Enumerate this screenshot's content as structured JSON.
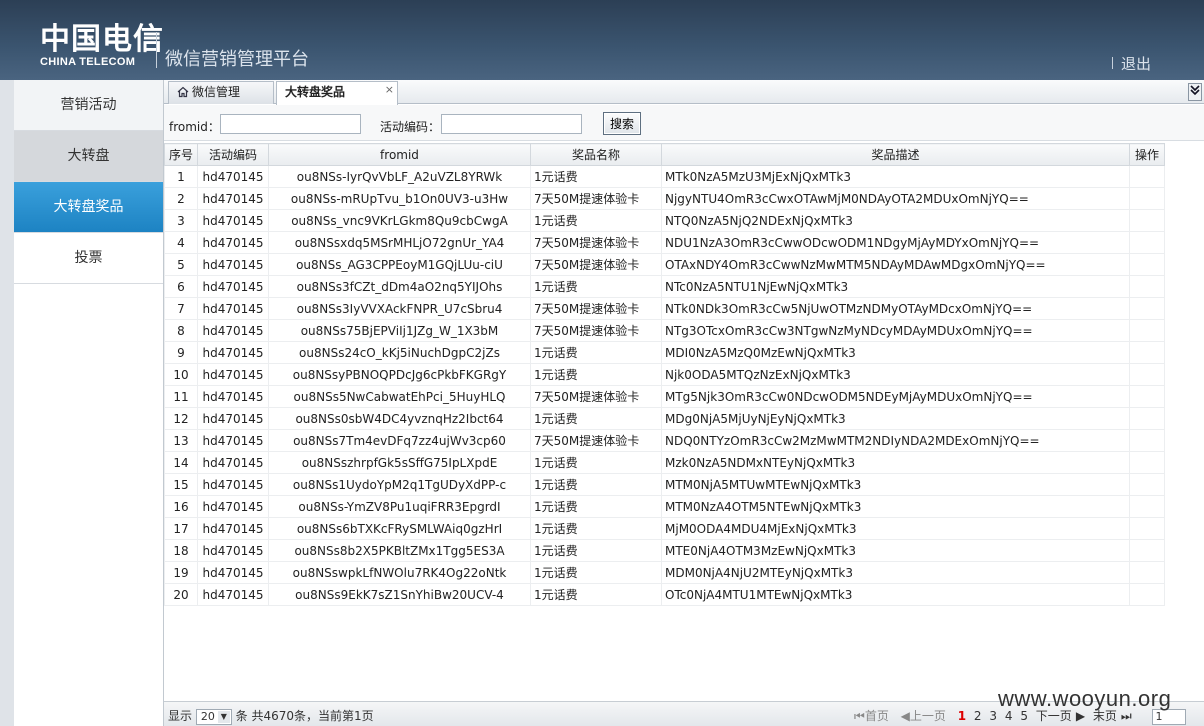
{
  "header": {
    "logo_cn": "中国电信",
    "logo_en": "CHINA TELECOM",
    "platform_title": "微信营销管理平台",
    "logout_label": "退出"
  },
  "sidebar": {
    "items": [
      {
        "label": "营销活动"
      },
      {
        "label": "大转盘"
      },
      {
        "label": "大转盘奖品"
      },
      {
        "label": "投票"
      }
    ]
  },
  "tabs": [
    {
      "label": "微信管理"
    },
    {
      "label": "大转盘奖品",
      "close": "×"
    }
  ],
  "tab_scroll_icon": "double-chevron-down-icon",
  "search": {
    "fromid_label": "fromid：",
    "fromid_value": "",
    "activity_label": "活动编码：",
    "activity_value": "",
    "button_label": "搜索"
  },
  "table": {
    "columns": [
      "序号",
      "活动编码",
      "fromid",
      "奖品名称",
      "奖品描述",
      "操作"
    ],
    "rows": [
      [
        "1",
        "hd470145",
        "ou8NSs-IyrQvVbLF_A2uVZL8YRWk",
        "1元话费",
        "MTk0NzA5MzU3MjExNjQxMTk3",
        ""
      ],
      [
        "2",
        "hd470145",
        "ou8NSs-mRUpTvu_b1On0UV3-u3Hw",
        "7天50M提速体验卡",
        "NjgyNTU4OmR3cCwxOTAwMjM0NDAyOTA2MDUxOmNjYQ==",
        ""
      ],
      [
        "3",
        "hd470145",
        "ou8NSs_vnc9VKrLGkm8Qu9cbCwgA",
        "1元话费",
        "NTQ0NzA5NjQ2NDExNjQxMTk3",
        ""
      ],
      [
        "4",
        "hd470145",
        "ou8NSsxdq5MSrMHLjO72gnUr_YA4",
        "7天50M提速体验卡",
        "NDU1NzA3OmR3cCwwODcwODM1NDgyMjAyMDYxOmNjYQ==",
        ""
      ],
      [
        "5",
        "hd470145",
        "ou8NSs_AG3CPPEoyM1GQjLUu-ciU",
        "7天50M提速体验卡",
        "OTAxNDY4OmR3cCwwNzMwMTM5NDAyMDAwMDgxOmNjYQ==",
        ""
      ],
      [
        "6",
        "hd470145",
        "ou8NSs3fCZt_dDm4aO2nq5YIJOhs",
        "1元话费",
        "NTc0NzA5NTU1NjEwNjQxMTk3",
        ""
      ],
      [
        "7",
        "hd470145",
        "ou8NSs3IyVVXAckFNPR_U7cSbru4",
        "7天50M提速体验卡",
        "NTk0NDk3OmR3cCw5NjUwOTMzNDMyOTAyMDcxOmNjYQ==",
        ""
      ],
      [
        "8",
        "hd470145",
        "ou8NSs75BjEPViIj1JZg_W_1X3bM",
        "7天50M提速体验卡",
        "NTg3OTcxOmR3cCw3NTgwNzMyNDcyMDAyMDUxOmNjYQ==",
        ""
      ],
      [
        "9",
        "hd470145",
        "ou8NSs24cO_kKj5iNuchDgpC2jZs",
        "1元话费",
        "MDI0NzA5MzQ0MzEwNjQxMTk3",
        ""
      ],
      [
        "10",
        "hd470145",
        "ou8NSsyPBNOQPDcJg6cPkbFKGRgY",
        "1元话费",
        "Njk0ODA5MTQzNzExNjQxMTk3",
        ""
      ],
      [
        "11",
        "hd470145",
        "ou8NSs5NwCabwatEhPci_5HuyHLQ",
        "7天50M提速体验卡",
        "MTg5Njk3OmR3cCw0NDcwODM5NDEyMjAyMDUxOmNjYQ==",
        ""
      ],
      [
        "12",
        "hd470145",
        "ou8NSs0sbW4DC4yvznqHz2Ibct64",
        "1元话费",
        "MDg0NjA5MjUyNjEyNjQxMTk3",
        ""
      ],
      [
        "13",
        "hd470145",
        "ou8NSs7Tm4evDFq7zz4ujWv3cp60",
        "7天50M提速体验卡",
        "NDQ0NTYzOmR3cCw2MzMwMTM2NDIyNDA2MDExOmNjYQ==",
        ""
      ],
      [
        "14",
        "hd470145",
        "ou8NSszhrpfGk5sSffG75IpLXpdE",
        "1元话费",
        "Mzk0NzA5NDMxNTEyNjQxMTk3",
        ""
      ],
      [
        "15",
        "hd470145",
        "ou8NSs1UydoYpM2q1TgUDyXdPP-c",
        "1元话费",
        "MTM0NjA5MTUwMTEwNjQxMTk3",
        ""
      ],
      [
        "16",
        "hd470145",
        "ou8NSs-YmZV8Pu1uqiFRR3EpgrdI",
        "1元话费",
        "MTM0NzA4OTM5NTEwNjQxMTk3",
        ""
      ],
      [
        "17",
        "hd470145",
        "ou8NSs6bTXKcFRySMLWAiq0gzHrI",
        "1元话费",
        "MjM0ODA4MDU4MjExNjQxMTk3",
        ""
      ],
      [
        "18",
        "hd470145",
        "ou8NSs8b2X5PKBltZMx1Tgg5ES3A",
        "1元话费",
        "MTE0NjA4OTM3MzEwNjQxMTk3",
        ""
      ],
      [
        "19",
        "hd470145",
        "ou8NSswpkLfNWOlu7RK4Og22oNtk",
        "1元话费",
        "MDM0NjA4NjU2MTEyNjQxMTk3",
        ""
      ],
      [
        "20",
        "hd470145",
        "ou8NSs9EkK7sZ1SnYhiBw20UCV-4",
        "1元话费",
        "OTc0NjA4MTU1MTEwNjQxMTk3",
        ""
      ]
    ]
  },
  "pager": {
    "show_label": "显示",
    "page_size": "20",
    "summary": "条 共4670条，当前第1页",
    "first": "首页",
    "prev": "上一页",
    "pages": [
      "1",
      "2",
      "3",
      "4",
      "5"
    ],
    "next": "下一页",
    "last": "末页",
    "goto_value": "1"
  },
  "watermark": "www.wooyun.org",
  "colors": {
    "header_bg": "#3b5570",
    "nav_active": "#2a90cf",
    "current_page": "#dd0000"
  }
}
